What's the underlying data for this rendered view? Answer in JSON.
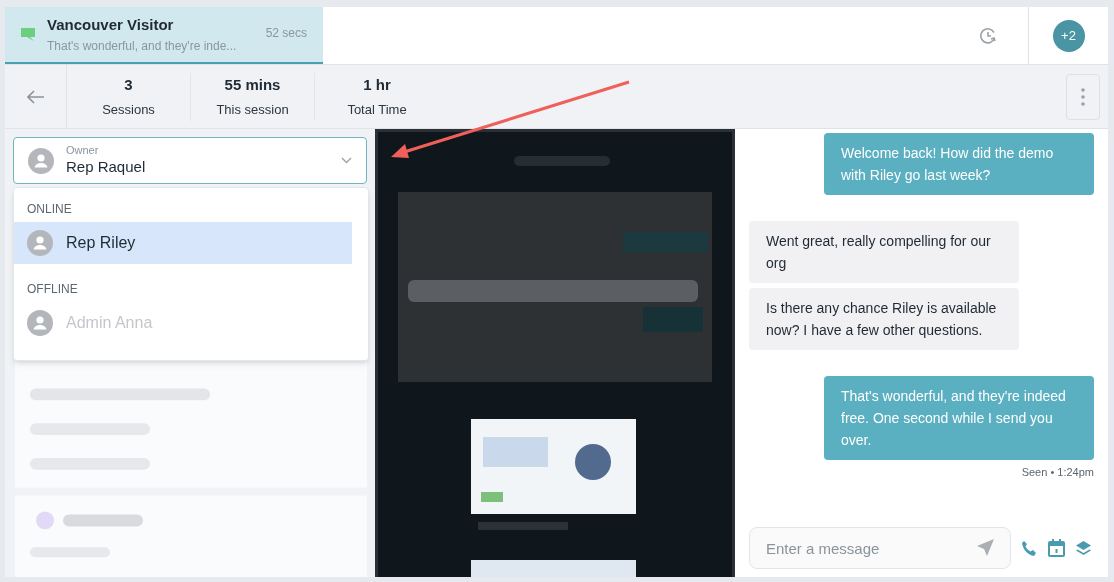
{
  "conversation_tab": {
    "title": "Vancouver Visitor",
    "preview": "That's wonderful, and they're inde...",
    "time": "52 secs",
    "selected": true
  },
  "participants_badge": "+2",
  "stats": [
    {
      "value": "3",
      "label": "Sessions"
    },
    {
      "value": "55 mins",
      "label": "This session"
    },
    {
      "value": "1 hr",
      "label": "Total Time"
    }
  ],
  "owner_select": {
    "label": "Owner",
    "value": "Rep Raquel",
    "expanded": true
  },
  "owner_menu": [
    {
      "heading": "ONLINE",
      "items": [
        {
          "name": "Rep Riley",
          "selected": true,
          "disabled": false
        }
      ]
    },
    {
      "heading": "OFFLINE",
      "items": [
        {
          "name": "Admin Anna",
          "selected": false,
          "disabled": true
        }
      ]
    }
  ],
  "messages": [
    {
      "kind": "outgoing",
      "text": "Welcome back! How did the demo with Riley go last week?"
    },
    {
      "kind": "incoming",
      "text": "Went great, really compelling for our org"
    },
    {
      "kind": "incoming",
      "text": "Is there any chance Riley is available now? I have a few other questions."
    },
    {
      "kind": "outgoing",
      "text": "That's wonderful, and they're indeed free. One second while I send you over."
    }
  ],
  "receipt": "Seen • 1:24pm",
  "composer": {
    "placeholder": "Enter a message"
  }
}
